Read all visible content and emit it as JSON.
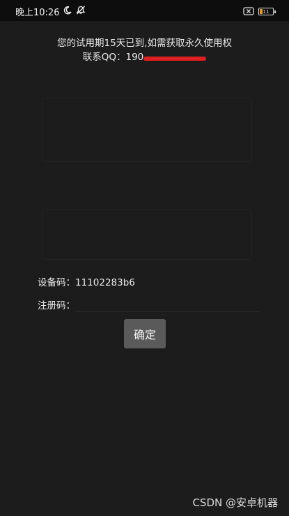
{
  "status_bar": {
    "time": "晚上10:26",
    "battery_level": "11"
  },
  "notice": {
    "line1": "您的试用期15天已到,如需获取永久使用权",
    "qq_label": "联系QQ：",
    "qq_visible": "190"
  },
  "form": {
    "device_label": "设备码：",
    "device_code": "11102283b6",
    "register_label": "注册码：",
    "register_value": ""
  },
  "confirm_label": "确定",
  "watermark": "CSDN @安卓机器"
}
